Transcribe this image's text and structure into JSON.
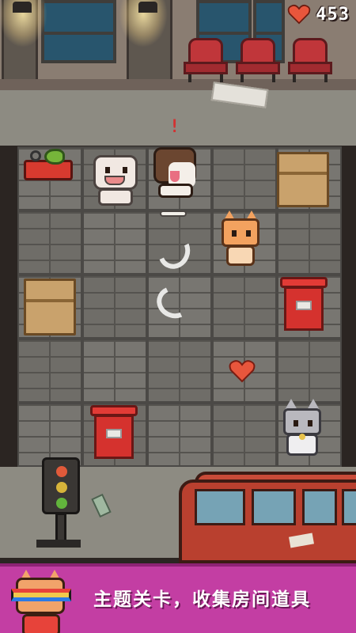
{
  "hud": {
    "score": "453",
    "heart_icon": "heart-icon"
  },
  "banner": {
    "text": "主题关卡，收集房间道具",
    "mascot_icon": "cat-with-sunglasses-icon"
  },
  "colors": {
    "banner_bg": "#c33ea3",
    "heart": "#e8563c",
    "score_text": "#ffffff"
  },
  "board": {
    "rows": 5,
    "cols": 5,
    "pieces": [
      {
        "name": "fish-can-piece",
        "icon": "fish-in-can-icon"
      },
      {
        "name": "white-dog-piece",
        "icon": "white-dog-icon"
      },
      {
        "name": "husky-dog-piece",
        "icon": "husky-dog-icon",
        "alert": "!"
      },
      {
        "name": "cardboard-box-piece",
        "icon": "box-icon"
      },
      {
        "name": "orange-cat-piece",
        "icon": "orange-cat-icon"
      },
      {
        "name": "trash-bin-piece",
        "icon": "trash-bin-icon"
      },
      {
        "name": "heart-pickup",
        "icon": "heart-icon"
      },
      {
        "name": "grey-cat-piece",
        "icon": "grey-cat-icon"
      }
    ]
  }
}
